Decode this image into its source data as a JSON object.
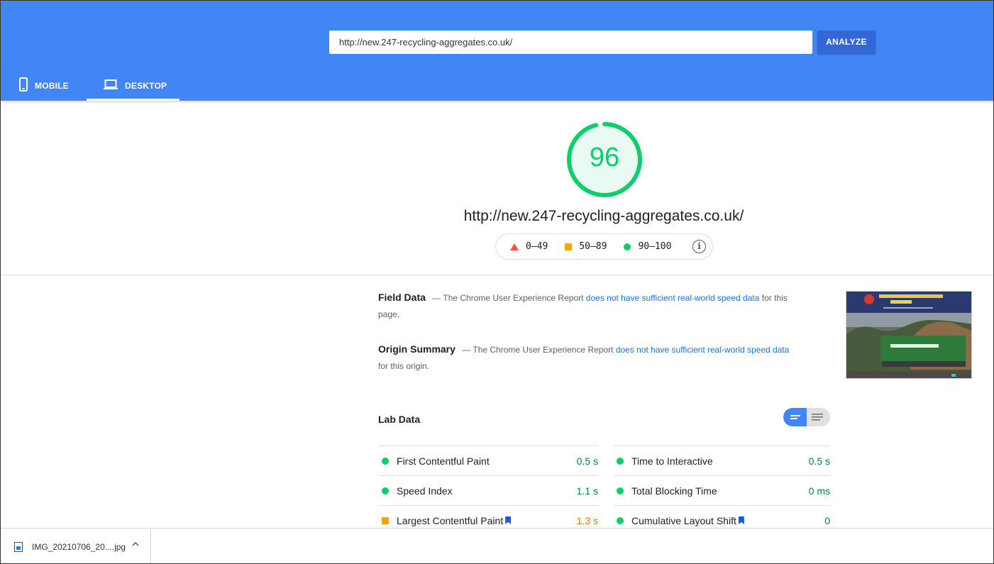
{
  "header": {
    "url_value": "http://new.247-recycling-aggregates.co.uk/",
    "analyze_label": "ANALYZE",
    "tabs": [
      {
        "label": "MOBILE",
        "icon": "mobile-phone-icon",
        "active": false
      },
      {
        "label": "DESKTOP",
        "icon": "laptop-icon",
        "active": true
      }
    ],
    "bg_color": "#4285f4"
  },
  "score": {
    "value": "96",
    "fraction": 0.96,
    "color": "#0cce6b",
    "tested_url": "http://new.247-recycling-aggregates.co.uk/"
  },
  "legend": {
    "fail": "0–49",
    "average": "50–89",
    "pass": "90–100",
    "info_icon": "info-icon"
  },
  "field_data": {
    "title": "Field Data",
    "prefix": "— The Chrome User Experience Report ",
    "link": "does not have sufficient real-world speed data",
    "suffix": " for this page."
  },
  "origin_summary": {
    "title": "Origin Summary",
    "prefix": "— The Chrome User Experience Report ",
    "link": "does not have sufficient real-world speed data",
    "suffix": " for this origin."
  },
  "lab_data": {
    "title": "Lab Data",
    "metrics_left": [
      {
        "label": "First Contentful Paint",
        "value": "0.5 s",
        "status": "pass",
        "bookmark": false
      },
      {
        "label": "Speed Index",
        "value": "1.1 s",
        "status": "pass",
        "bookmark": false
      },
      {
        "label": "Largest Contentful Paint",
        "value": "1.3 s",
        "status": "average",
        "bookmark": true
      }
    ],
    "metrics_right": [
      {
        "label": "Time to Interactive",
        "value": "0.5 s",
        "status": "pass",
        "bookmark": false
      },
      {
        "label": "Total Blocking Time",
        "value": "0 ms",
        "status": "pass",
        "bookmark": false
      },
      {
        "label": "Cumulative Layout Shift",
        "value": "0",
        "status": "pass",
        "bookmark": true
      }
    ]
  },
  "download_bar": {
    "filename": "IMG_20210706_20....jpg"
  }
}
